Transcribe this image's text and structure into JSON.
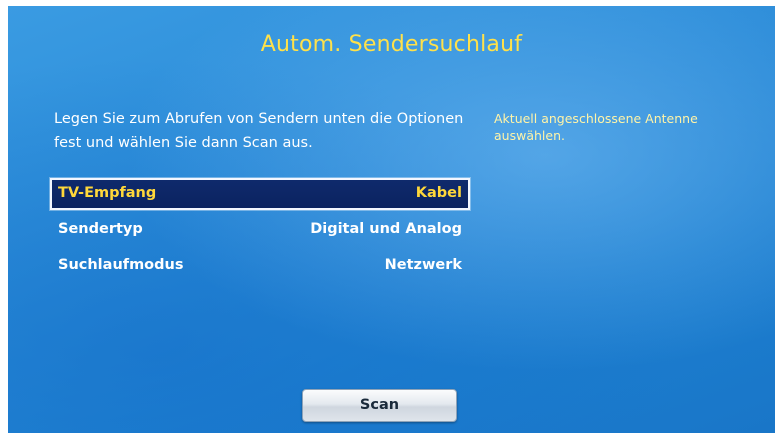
{
  "screen": {
    "title": "Autom. Sendersuchlauf",
    "instructions": "Legen Sie zum Abrufen von Sendern unten die Optionen fest und wählen Sie dann Scan aus.",
    "help_text": "Aktuell angeschlossene Antenne auswählen."
  },
  "menu": {
    "items": [
      {
        "label": "TV-Empfang",
        "value": "Kabel",
        "selected": true
      },
      {
        "label": "Sendertyp",
        "value": "Digital und Analog",
        "selected": false
      },
      {
        "label": "Suchlaufmodus",
        "value": "Netzwerk",
        "selected": false
      }
    ]
  },
  "actions": {
    "scan_label": "Scan"
  },
  "colors": {
    "background": "#2a8bd8",
    "title": "#ffe14a",
    "help_text": "#fff4a8",
    "selected_row": "#0f2a6c",
    "selected_text": "#ffd83a"
  }
}
